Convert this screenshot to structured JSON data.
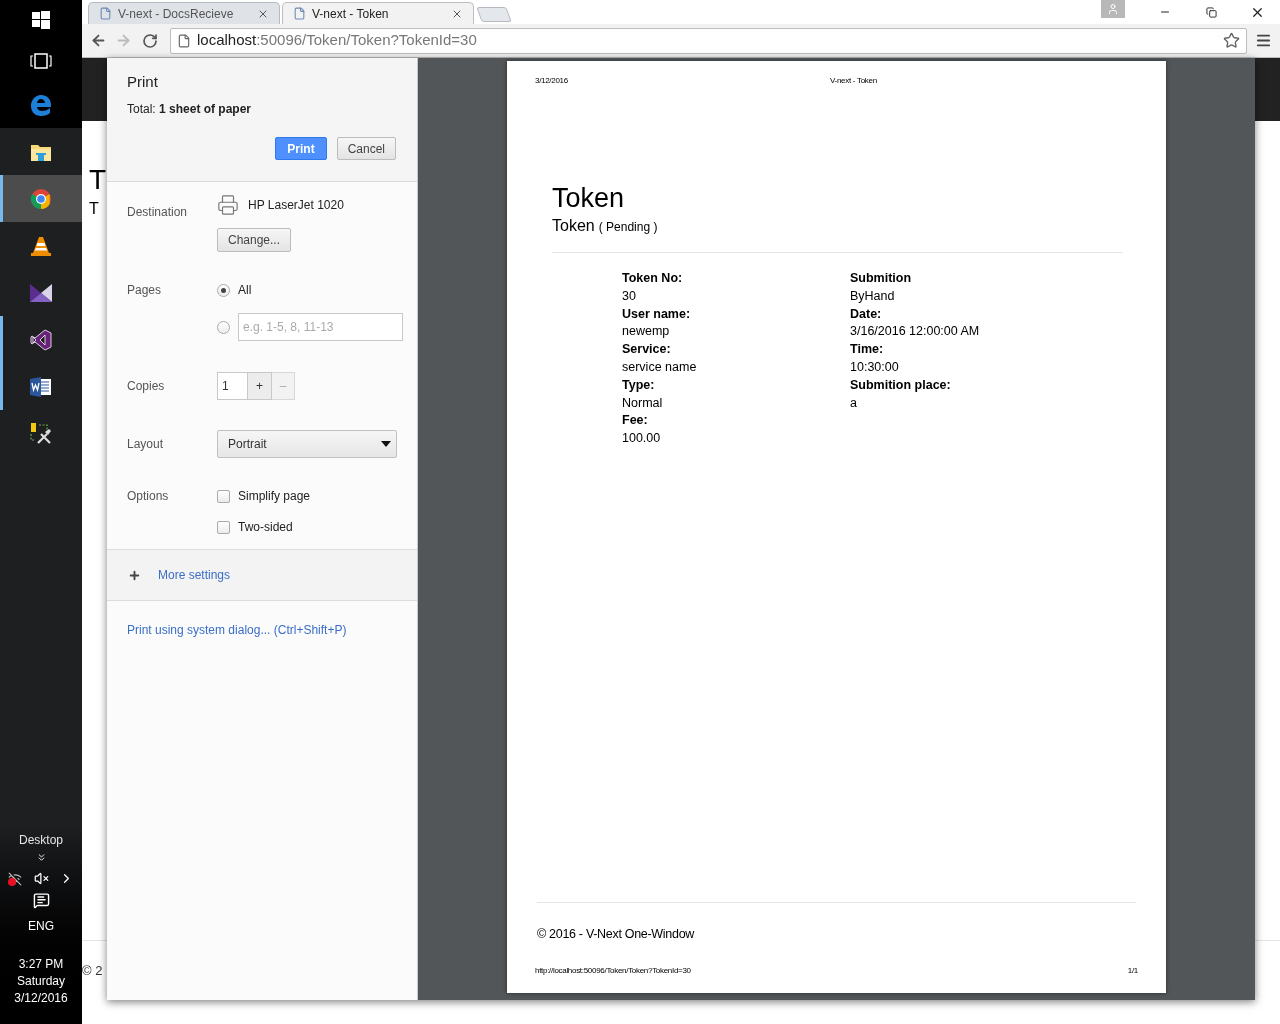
{
  "taskbar": {
    "apps": [
      {
        "kind": "start",
        "selected": false,
        "running": false
      },
      {
        "kind": "taskview",
        "selected": false,
        "running": false
      },
      {
        "kind": "edge",
        "selected": false,
        "running": false
      },
      {
        "kind": "explorer",
        "selected": false,
        "running": false
      },
      {
        "kind": "chrome",
        "selected": true,
        "running": true
      },
      {
        "kind": "vlc",
        "selected": false,
        "running": false
      },
      {
        "kind": "blend",
        "selected": false,
        "running": false
      },
      {
        "kind": "studio",
        "selected": false,
        "running": true
      },
      {
        "kind": "word",
        "selected": false,
        "running": true
      },
      {
        "kind": "tools",
        "selected": false,
        "running": false
      }
    ],
    "desktop_label": "Desktop",
    "language": "ENG",
    "time": "3:27 PM",
    "day": "Saturday",
    "date": "3/12/2016"
  },
  "browser": {
    "tabs": [
      {
        "title": "V-next - DocsRecieve",
        "selected": false
      },
      {
        "title": "V-next - Token",
        "selected": true
      }
    ],
    "address": {
      "host": "localhost",
      "rest": ":50096/Token/Token?TokenId=30"
    }
  },
  "background_page": {
    "heading": "T",
    "subheading": "T",
    "footer": "© 2"
  },
  "print_panel": {
    "title": "Print",
    "total": "Total: **1 sheet of paper**",
    "print_button": "Print",
    "cancel_button": "Cancel",
    "destination": {
      "label": "Destination",
      "printer": "HP LaserJet 1020",
      "change_button": "Change..."
    },
    "pages": {
      "label": "Pages",
      "options": [
        {
          "kind": "all",
          "label": "All",
          "selected": true
        },
        {
          "kind": "range",
          "placeholder": "e.g. 1-5, 8, 11-13",
          "selected": false
        }
      ]
    },
    "copies": {
      "label": "Copies",
      "value": "1",
      "increment": "+",
      "decrement": "–"
    },
    "layout": {
      "label": "Layout",
      "value": "Portrait"
    },
    "options": {
      "label": "Options",
      "items": [
        {
          "label": "Simplify page",
          "checked": false
        },
        {
          "label": "Two-sided",
          "checked": false
        }
      ]
    },
    "more_settings": "More settings",
    "system_dialog": "Print using system dialog... (Ctrl+Shift+P)"
  },
  "preview": {
    "header_date": "3/12/2016",
    "header_title": "V-next - Token",
    "title": "Token",
    "subtitle": "Token",
    "status": "( Pending )",
    "columns": [
      [
        {
          "label": "Token No:",
          "value": "30"
        },
        {
          "label": "User name:",
          "value": "newemp"
        },
        {
          "label": "Service:",
          "value": "service name"
        },
        {
          "label": "Type:",
          "value": "Normal"
        },
        {
          "label": "Fee:",
          "value": "100.00"
        }
      ],
      [
        {
          "label": "Submition",
          "value": "ByHand"
        },
        {
          "label": "Date:",
          "value": "3/16/2016 12:00:00 AM"
        },
        {
          "label": "Time:",
          "value": "10:30:00"
        },
        {
          "label": "Submition place:",
          "value": "a"
        }
      ]
    ],
    "footer": "© 2016 - V-Next One-Window",
    "footer_url": "http://localhost:50096/Token/Token?TokenId=30",
    "page_number": "1/1"
  }
}
